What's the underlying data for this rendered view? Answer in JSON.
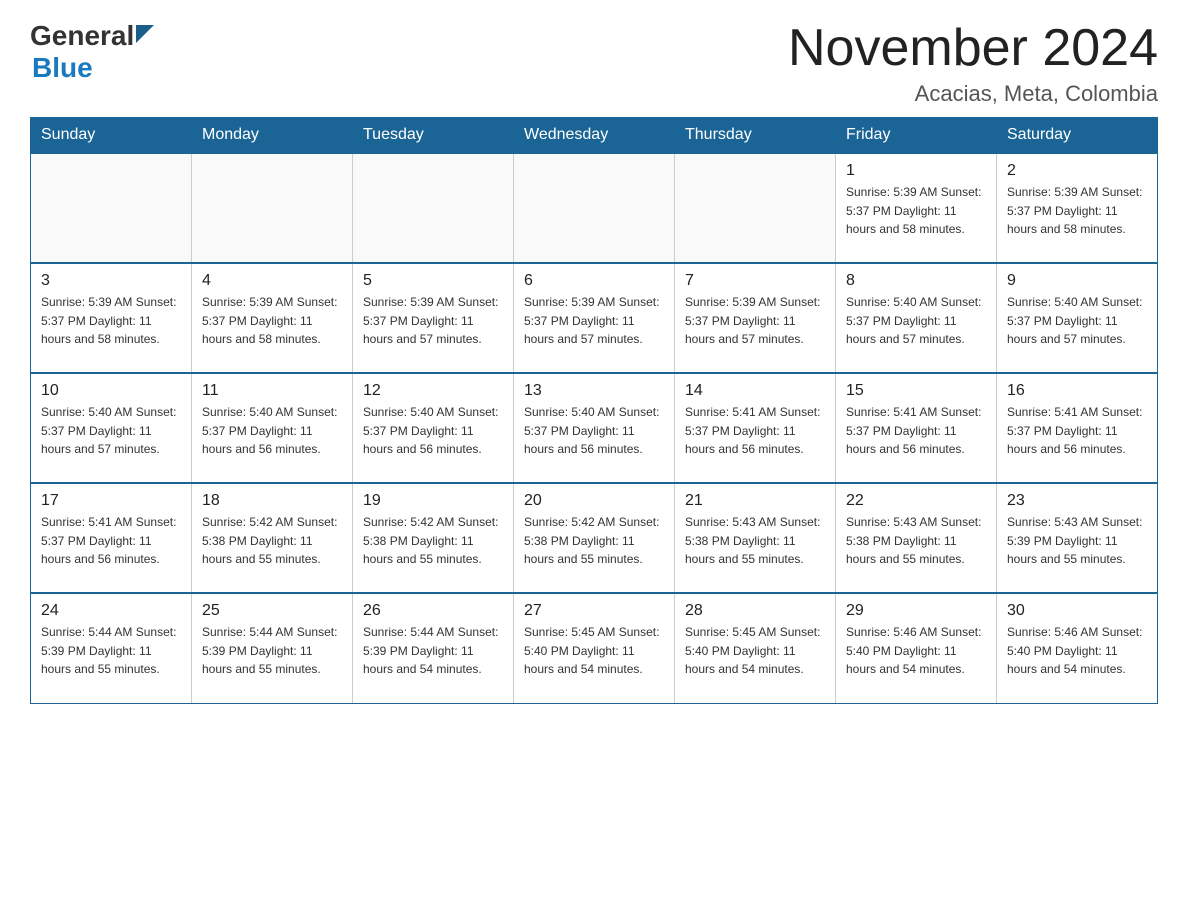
{
  "header": {
    "title": "November 2024",
    "subtitle": "Acacias, Meta, Colombia"
  },
  "logo": {
    "general": "General",
    "blue": "Blue"
  },
  "weekdays": [
    "Sunday",
    "Monday",
    "Tuesday",
    "Wednesday",
    "Thursday",
    "Friday",
    "Saturday"
  ],
  "weeks": [
    [
      {
        "day": "",
        "info": ""
      },
      {
        "day": "",
        "info": ""
      },
      {
        "day": "",
        "info": ""
      },
      {
        "day": "",
        "info": ""
      },
      {
        "day": "",
        "info": ""
      },
      {
        "day": "1",
        "info": "Sunrise: 5:39 AM\nSunset: 5:37 PM\nDaylight: 11 hours and 58 minutes."
      },
      {
        "day": "2",
        "info": "Sunrise: 5:39 AM\nSunset: 5:37 PM\nDaylight: 11 hours and 58 minutes."
      }
    ],
    [
      {
        "day": "3",
        "info": "Sunrise: 5:39 AM\nSunset: 5:37 PM\nDaylight: 11 hours and 58 minutes."
      },
      {
        "day": "4",
        "info": "Sunrise: 5:39 AM\nSunset: 5:37 PM\nDaylight: 11 hours and 58 minutes."
      },
      {
        "day": "5",
        "info": "Sunrise: 5:39 AM\nSunset: 5:37 PM\nDaylight: 11 hours and 57 minutes."
      },
      {
        "day": "6",
        "info": "Sunrise: 5:39 AM\nSunset: 5:37 PM\nDaylight: 11 hours and 57 minutes."
      },
      {
        "day": "7",
        "info": "Sunrise: 5:39 AM\nSunset: 5:37 PM\nDaylight: 11 hours and 57 minutes."
      },
      {
        "day": "8",
        "info": "Sunrise: 5:40 AM\nSunset: 5:37 PM\nDaylight: 11 hours and 57 minutes."
      },
      {
        "day": "9",
        "info": "Sunrise: 5:40 AM\nSunset: 5:37 PM\nDaylight: 11 hours and 57 minutes."
      }
    ],
    [
      {
        "day": "10",
        "info": "Sunrise: 5:40 AM\nSunset: 5:37 PM\nDaylight: 11 hours and 57 minutes."
      },
      {
        "day": "11",
        "info": "Sunrise: 5:40 AM\nSunset: 5:37 PM\nDaylight: 11 hours and 56 minutes."
      },
      {
        "day": "12",
        "info": "Sunrise: 5:40 AM\nSunset: 5:37 PM\nDaylight: 11 hours and 56 minutes."
      },
      {
        "day": "13",
        "info": "Sunrise: 5:40 AM\nSunset: 5:37 PM\nDaylight: 11 hours and 56 minutes."
      },
      {
        "day": "14",
        "info": "Sunrise: 5:41 AM\nSunset: 5:37 PM\nDaylight: 11 hours and 56 minutes."
      },
      {
        "day": "15",
        "info": "Sunrise: 5:41 AM\nSunset: 5:37 PM\nDaylight: 11 hours and 56 minutes."
      },
      {
        "day": "16",
        "info": "Sunrise: 5:41 AM\nSunset: 5:37 PM\nDaylight: 11 hours and 56 minutes."
      }
    ],
    [
      {
        "day": "17",
        "info": "Sunrise: 5:41 AM\nSunset: 5:37 PM\nDaylight: 11 hours and 56 minutes."
      },
      {
        "day": "18",
        "info": "Sunrise: 5:42 AM\nSunset: 5:38 PM\nDaylight: 11 hours and 55 minutes."
      },
      {
        "day": "19",
        "info": "Sunrise: 5:42 AM\nSunset: 5:38 PM\nDaylight: 11 hours and 55 minutes."
      },
      {
        "day": "20",
        "info": "Sunrise: 5:42 AM\nSunset: 5:38 PM\nDaylight: 11 hours and 55 minutes."
      },
      {
        "day": "21",
        "info": "Sunrise: 5:43 AM\nSunset: 5:38 PM\nDaylight: 11 hours and 55 minutes."
      },
      {
        "day": "22",
        "info": "Sunrise: 5:43 AM\nSunset: 5:38 PM\nDaylight: 11 hours and 55 minutes."
      },
      {
        "day": "23",
        "info": "Sunrise: 5:43 AM\nSunset: 5:39 PM\nDaylight: 11 hours and 55 minutes."
      }
    ],
    [
      {
        "day": "24",
        "info": "Sunrise: 5:44 AM\nSunset: 5:39 PM\nDaylight: 11 hours and 55 minutes."
      },
      {
        "day": "25",
        "info": "Sunrise: 5:44 AM\nSunset: 5:39 PM\nDaylight: 11 hours and 55 minutes."
      },
      {
        "day": "26",
        "info": "Sunrise: 5:44 AM\nSunset: 5:39 PM\nDaylight: 11 hours and 54 minutes."
      },
      {
        "day": "27",
        "info": "Sunrise: 5:45 AM\nSunset: 5:40 PM\nDaylight: 11 hours and 54 minutes."
      },
      {
        "day": "28",
        "info": "Sunrise: 5:45 AM\nSunset: 5:40 PM\nDaylight: 11 hours and 54 minutes."
      },
      {
        "day": "29",
        "info": "Sunrise: 5:46 AM\nSunset: 5:40 PM\nDaylight: 11 hours and 54 minutes."
      },
      {
        "day": "30",
        "info": "Sunrise: 5:46 AM\nSunset: 5:40 PM\nDaylight: 11 hours and 54 minutes."
      }
    ]
  ]
}
